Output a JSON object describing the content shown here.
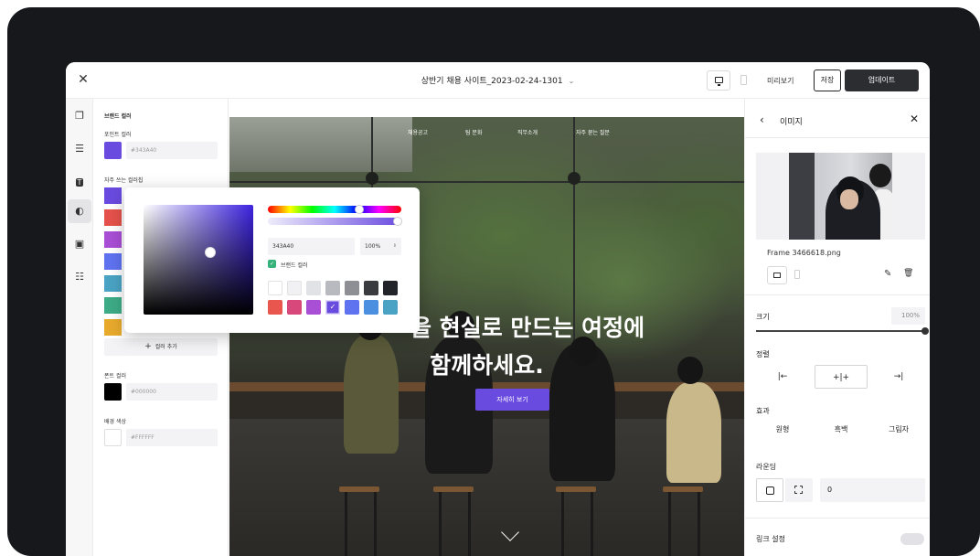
{
  "topbar": {
    "close_label": "✕",
    "title": "상반기 채용 사이트_2023-02-24-1301",
    "title_chevron": "⌄",
    "preview_label": "미리보기",
    "save_label": "저장",
    "update_label": "업데이트"
  },
  "rail": {
    "icons": [
      "pages-icon",
      "list-icon",
      "text-icon",
      "theme-icon",
      "image-icon",
      "layout-icon"
    ],
    "glyphs": [
      "❐",
      "☰",
      "T",
      "◐",
      "▣",
      "☷"
    ],
    "active_index": 3
  },
  "color_panel": {
    "title": "브랜드 컬러",
    "point_label": "포인트 컬러",
    "point_hex": "#343A40",
    "point_color": "#6a4be0",
    "favorites_label": "자주 쓰는 컬러칩",
    "favorites": [
      "#6a4be0",
      "#e5524b",
      "#a94fd6",
      "#5f72f0",
      "#4aa3c4",
      "#3eac86",
      "#e8aa2d"
    ],
    "add_color_label": "컬러 추가",
    "font_label": "폰트 컬러",
    "font_hex": "#000000",
    "font_color": "#000000",
    "bg_label": "배경 색상",
    "bg_hex": "#FFFFFF",
    "bg_color": "#ffffff"
  },
  "picker": {
    "hex_value": "343A40",
    "opacity_value": "100%",
    "brand_checkbox_label": "브랜드 컬러",
    "swatches_row1": [
      "#ffffff",
      "#f1f1f3",
      "#e1e2e6",
      "#b8bac0",
      "#8d8f95",
      "#3a3b3f",
      "#23242a"
    ],
    "swatches_row2": [
      "#e8564d",
      "#d9487a",
      "#a94fd6",
      "#6a4be0",
      "#5f72f0",
      "#4a8fe0",
      "#4aa3c4"
    ],
    "selected_swatch_index": 3
  },
  "hero": {
    "nav": [
      "채용공고",
      "팀 문화",
      "직무소개",
      "자주 묻는 질문"
    ],
    "headline_line1": "을 현실로 만드는 여정에",
    "headline_line2": "함께하세요.",
    "cta_label": "자세히 보기"
  },
  "image_panel": {
    "title": "이미지",
    "back_label": "‹",
    "close_label": "✕",
    "file_name": "Frame 3466618.png",
    "size_label": "크기",
    "size_value": "100%",
    "size_fraction": 1.0,
    "align_label": "정렬",
    "align_options": [
      "|←",
      "+|+",
      "→|"
    ],
    "align_selected": 1,
    "effect_label": "효과",
    "effect_options": [
      "원형",
      "흑백",
      "그림자"
    ],
    "rounding_label": "라운딩",
    "rounding_value": "0",
    "link_label": "링크 설정"
  }
}
